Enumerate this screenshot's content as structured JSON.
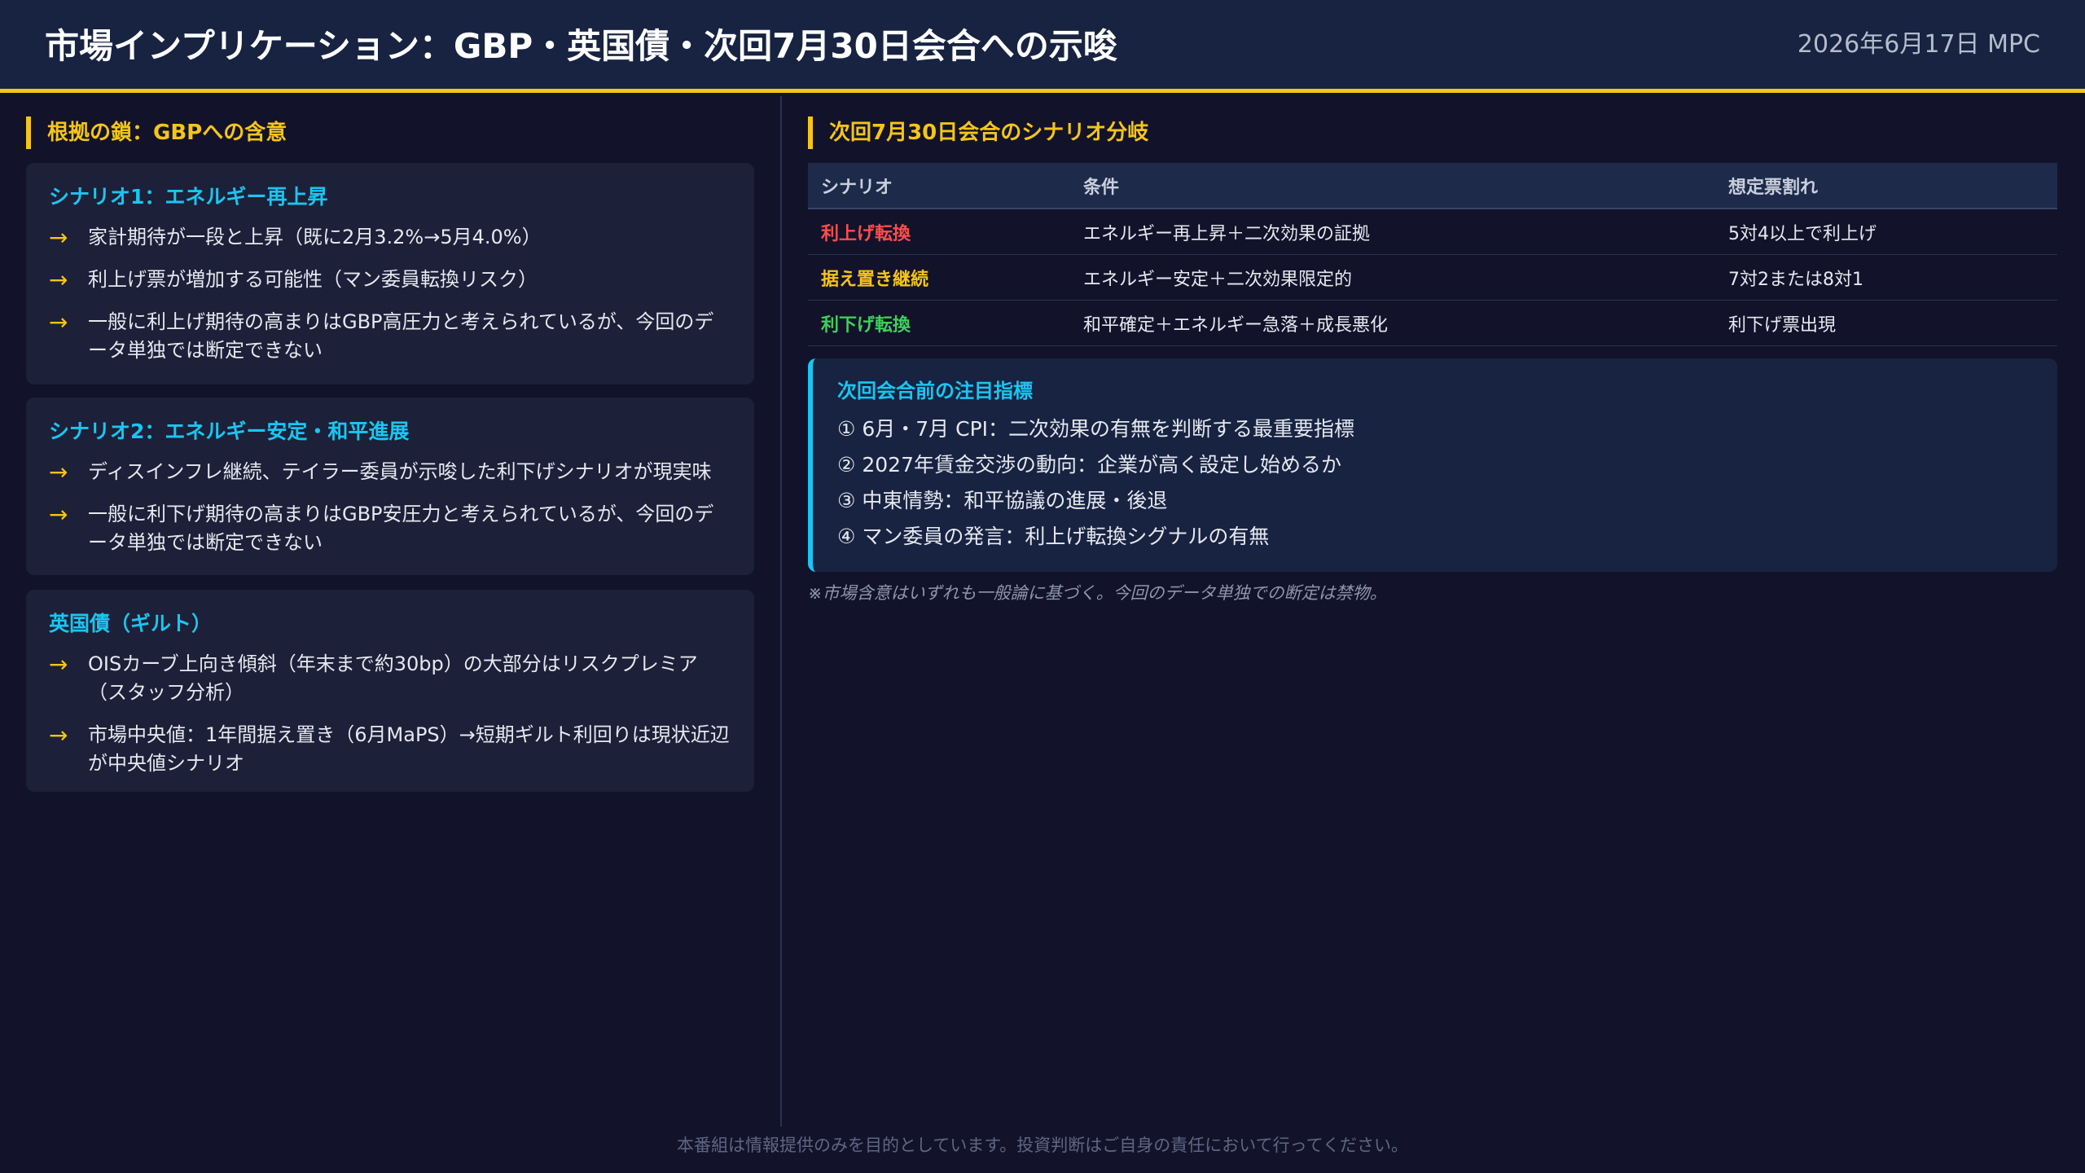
{
  "header": {
    "title": "市場インプリケーション：GBP・英国債・次回7月30日会合への示唆",
    "date": "2026年6月17日 MPC"
  },
  "left": {
    "heading": "根拠の鎖：GBPへの含意",
    "cards": [
      {
        "title": "シナリオ1：エネルギー再上昇",
        "bullets": [
          "家計期待が一段と上昇（既に2月3.2%→5月4.0%）",
          "利上げ票が増加する可能性（マン委員転換リスク）",
          "一般に利上げ期待の高まりはGBP高圧力と考えられているが、今回のデータ単独では断定できない"
        ]
      },
      {
        "title": "シナリオ2：エネルギー安定・和平進展",
        "bullets": [
          "ディスインフレ継続、テイラー委員が示唆した利下げシナリオが現実味",
          "一般に利下げ期待の高まりはGBP安圧力と考えられているが、今回のデータ単独では断定できない"
        ]
      },
      {
        "title": "英国債（ギルト）",
        "bullets": [
          "OISカーブ上向き傾斜（年末まで約30bp）の大部分はリスクプレミア（スタッフ分析）",
          "市場中央値：1年間据え置き（6月MaPS）→短期ギルト利回りは現状近辺が中央値シナリオ"
        ]
      }
    ],
    "arrow": "→"
  },
  "right": {
    "heading": "次回7月30日会合のシナリオ分岐",
    "table": {
      "headers": [
        "シナリオ",
        "条件",
        "想定票割れ"
      ],
      "rows": [
        {
          "scenario": "利上げ転換",
          "condition": "エネルギー再上昇＋二次効果の証拠",
          "votes": "5対4以上で利上げ",
          "color": "#ff4d4d"
        },
        {
          "scenario": "据え置き継続",
          "condition": "エネルギー安定＋二次効果限定的",
          "votes": "7対2または8対1",
          "color": "#f5c518"
        },
        {
          "scenario": "利下げ転換",
          "condition": "和平確定＋エネルギー急落＋成長悪化",
          "votes": "利下げ票出現",
          "color": "#3ecf5a"
        }
      ]
    },
    "watch": {
      "title": "次回会合前の注目指標",
      "items": [
        "① 6月・7月 CPI：二次効果の有無を判断する最重要指標",
        "② 2027年賃金交渉の動向：企業が高く設定し始めるか",
        "③ 中東情勢：和平協議の進展・後退",
        "④ マン委員の発言：利上げ転換シグナルの有無"
      ]
    },
    "note": "※市場含意はいずれも一般論に基づく。今回のデータ単独での断定は禁物。"
  },
  "footer": "本番組は情報提供のみを目的としています。投資判断はご自身の責任において行ってください。"
}
